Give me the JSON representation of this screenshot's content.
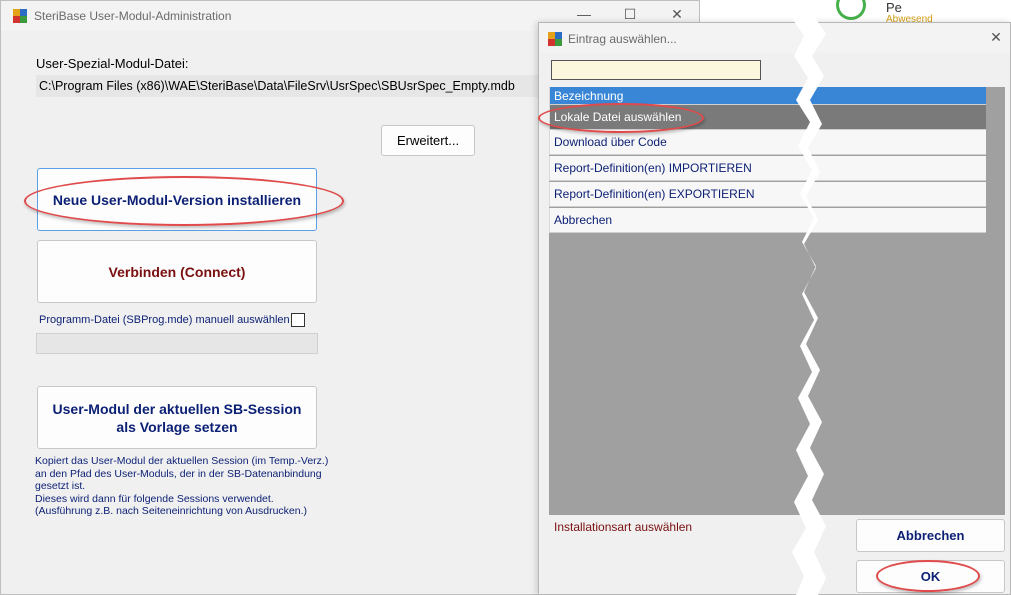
{
  "main_window": {
    "title": "SteriBase User-Modul-Administration",
    "controls": {
      "minimize": "—",
      "maximize": "☐",
      "close": "✕"
    },
    "path_label": "User-Spezial-Modul-Datei:",
    "path_value": "C:\\Program Files (x86)\\WAE\\SteriBase\\Data\\FileSrv\\UsrSpec\\SBUsrSpec_Empty.mdb",
    "erweitert_button": "Erweitert...",
    "install_button": "Neue User-Modul-Version installieren",
    "connect_button": "Verbinden (Connect)",
    "program_file_checkbox_label": "Programm-Datei (SBProg.mde) manuell auswählen",
    "program_file_checked": false,
    "template_button_line1": "User-Modul der aktuellen SB-Session",
    "template_button_line2": "als Vorlage setzen",
    "description_lines": [
      "Kopiert das User-Modul der aktuellen Session (im Temp.-Verz.)",
      "an den Pfad des User-Moduls, der in der SB-Datenanbindung",
      "gesetzt ist.",
      "Dieses wird dann für folgende Sessions verwendet.",
      "(Ausführung z.B. nach Seiteneinrichtung von Ausdrucken.)"
    ]
  },
  "dialog": {
    "title": "Eintrag auswählen...",
    "close": "✕",
    "search_value": "",
    "list_header": "Bezeichnung",
    "items": [
      "Lokale Datei auswählen",
      "Download über Code",
      "Report-Definition(en) IMPORTIEREN",
      "Report-Definition(en) EXPORTIEREN",
      "Abbrechen"
    ],
    "selected_index": 0,
    "status": "Installationsart auswählen",
    "cancel_button": "Abbrechen",
    "ok_button": "OK"
  },
  "background_app": {
    "name": "Pe",
    "status": "Abwesend"
  },
  "colors": {
    "highlight_ellipse": "#e04a4a",
    "list_header": "#3a86d6",
    "selected_row": "#7a7a7a",
    "link_text": "#0b1f74",
    "dark_red_text": "#7a0f0f"
  }
}
